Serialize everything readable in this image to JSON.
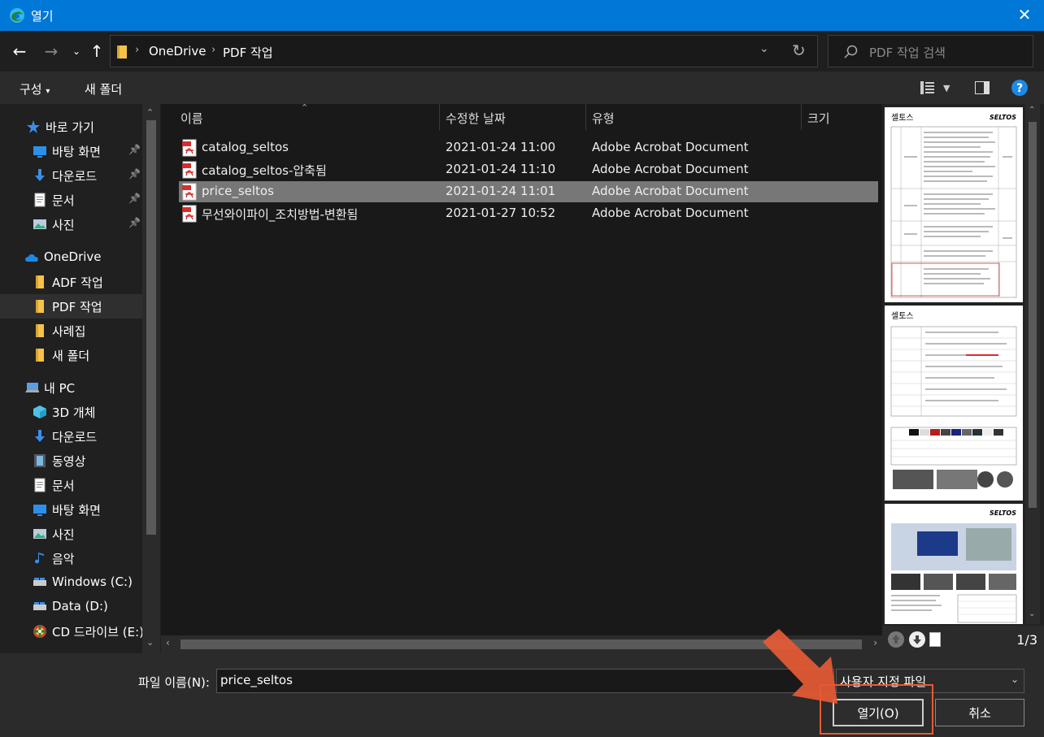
{
  "title": "열기",
  "nav": {
    "breadcrumb": [
      "OneDrive",
      "PDF 작업"
    ],
    "search_placeholder": "PDF 작업 검색"
  },
  "toolbar": {
    "organize": "구성",
    "new_folder": "새 폴더"
  },
  "sidebar": {
    "items": [
      {
        "label": "바로 가기",
        "icon": "star-icon"
      },
      {
        "label": "바탕 화면",
        "icon": "desktop-icon"
      },
      {
        "label": "다운로드",
        "icon": "download-icon"
      },
      {
        "label": "문서",
        "icon": "document-icon"
      },
      {
        "label": "사진",
        "icon": "picture-icon"
      },
      {
        "label": "OneDrive",
        "icon": "cloud-icon"
      },
      {
        "label": "ADF 작업",
        "icon": "folder-icon"
      },
      {
        "label": "PDF 작업",
        "icon": "folder-icon"
      },
      {
        "label": "사례집",
        "icon": "folder-icon"
      },
      {
        "label": "새 폴더",
        "icon": "folder-icon"
      },
      {
        "label": "내 PC",
        "icon": "pc-icon"
      },
      {
        "label": "3D 개체",
        "icon": "cube-icon"
      },
      {
        "label": "다운로드",
        "icon": "download-icon"
      },
      {
        "label": "동영상",
        "icon": "video-icon"
      },
      {
        "label": "문서",
        "icon": "document-icon"
      },
      {
        "label": "바탕 화면",
        "icon": "desktop-icon"
      },
      {
        "label": "사진",
        "icon": "picture-icon"
      },
      {
        "label": "음악",
        "icon": "music-icon"
      },
      {
        "label": "Windows (C:)",
        "icon": "drive-icon"
      },
      {
        "label": "Data (D:)",
        "icon": "drive-icon"
      },
      {
        "label": "CD 드라이브 (E:)",
        "icon": "cd-icon"
      }
    ]
  },
  "columns": [
    "이름",
    "수정한 날짜",
    "유형",
    "크기"
  ],
  "files": [
    {
      "name": "catalog_seltos",
      "date": "2021-01-24 11:00",
      "type": "Adobe Acrobat Document"
    },
    {
      "name": "catalog_seltos-압축됨",
      "date": "2021-01-24 11:10",
      "type": "Adobe Acrobat Document"
    },
    {
      "name": "price_seltos",
      "date": "2021-01-24 11:01",
      "type": "Adobe Acrobat Document"
    },
    {
      "name": "무선와이파이_조치방법-변환됨",
      "date": "2021-01-27 10:52",
      "type": "Adobe Acrobat Document"
    }
  ],
  "selected_file_index": 2,
  "preview": {
    "page_count": "1/3",
    "page1_title": "셀토스",
    "page1_brand": "SELTOS",
    "page2_title": "셀토스",
    "page3_brand": "SELTOS"
  },
  "bottom": {
    "filename_label": "파일 이름(N):",
    "filename_value": "price_seltos",
    "filter": "사용자 지정 파일",
    "open_button": "열기(O)",
    "cancel_button": "취소"
  },
  "colors": {
    "titlebar": "#0078d7",
    "annotation": "#e65a34",
    "selection": "#777777"
  }
}
